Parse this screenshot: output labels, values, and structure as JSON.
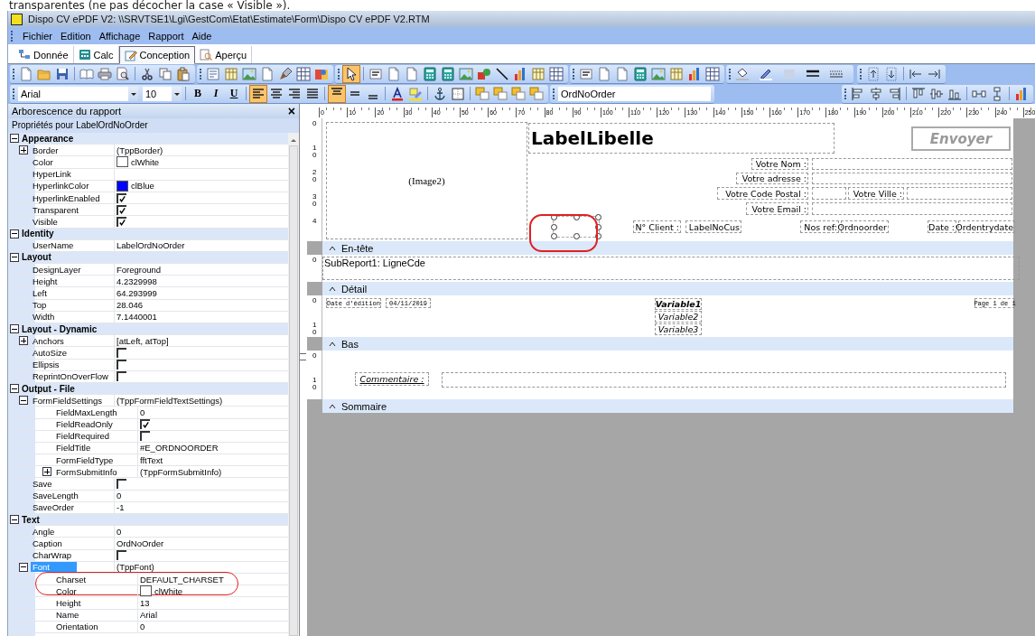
{
  "caption": "transparentes (ne pas décocher la case « Visible »).",
  "window": {
    "title": "Dispo CV ePDF V2: \\\\SRVTSE1\\Lgi\\GestCom\\Etat\\Estimate\\Form\\Dispo CV ePDF V2.RTM"
  },
  "menu": [
    "Fichier",
    "Edition",
    "Affichage",
    "Rapport",
    "Aide"
  ],
  "tabs": [
    {
      "label": "Donnée",
      "selected": false
    },
    {
      "label": "Calc",
      "selected": false
    },
    {
      "label": "Conception",
      "selected": true
    },
    {
      "label": "Aperçu",
      "selected": false
    }
  ],
  "toolbar": {
    "pointer_tool": {
      "selected": true
    },
    "font": "Arial",
    "size": "10",
    "format_buttons": [
      "B",
      "I",
      "U"
    ],
    "align": [
      {
        "selected": true
      },
      {
        "selected": false
      },
      {
        "selected": false
      },
      {
        "selected": false
      }
    ],
    "valign": [
      {
        "selected": true
      },
      {
        "selected": false
      },
      {
        "selected": false
      }
    ],
    "component_name": "OrdNoOrder"
  },
  "panel": {
    "title": "Arborescence du rapport",
    "close": "×",
    "subtitle": "Propriétés pour LabelOrdNoOrder"
  },
  "properties": [
    {
      "name": "Appearance",
      "expanded": true,
      "rows": [
        {
          "name": "Border",
          "kind": "text",
          "value": "(TppBorder)",
          "expanded": false,
          "selected": false
        },
        {
          "name": "Color",
          "kind": "color",
          "value": "clWhite",
          "color": "#ffffff",
          "selected": false
        },
        {
          "name": "HyperLink",
          "kind": "text",
          "selected": false
        },
        {
          "name": "HyperlinkColor",
          "kind": "color",
          "value": "clBlue",
          "color": "#0000ff",
          "selected": false
        },
        {
          "name": "HyperlinkEnabled",
          "kind": "check",
          "checked": true,
          "selected": false
        },
        {
          "name": "Transparent",
          "kind": "check",
          "checked": true,
          "selected": false
        },
        {
          "name": "Visible",
          "kind": "check",
          "checked": true,
          "selected": false
        }
      ]
    },
    {
      "name": "Identity",
      "expanded": true,
      "rows": [
        {
          "name": "UserName",
          "kind": "text",
          "value": "LabelOrdNoOrder",
          "selected": false
        }
      ]
    },
    {
      "name": "Layout",
      "expanded": true,
      "rows": [
        {
          "name": "DesignLayer",
          "kind": "text",
          "value": "Foreground",
          "selected": false
        },
        {
          "name": "Height",
          "kind": "text",
          "value": "4.2329998",
          "selected": false
        },
        {
          "name": "Left",
          "kind": "text",
          "value": "64.293999",
          "selected": false
        },
        {
          "name": "Top",
          "kind": "text",
          "value": "28.046",
          "selected": false
        },
        {
          "name": "Width",
          "kind": "text",
          "value": "7.1440001",
          "selected": false
        }
      ]
    },
    {
      "name": "Layout - Dynamic",
      "expanded": true,
      "rows": [
        {
          "name": "Anchors",
          "kind": "text",
          "value": "[atLeft, atTop]",
          "expanded": false,
          "selected": false
        },
        {
          "name": "AutoSize",
          "kind": "check",
          "checked": false,
          "selected": false
        },
        {
          "name": "Ellipsis",
          "kind": "check",
          "checked": false,
          "selected": false
        },
        {
          "name": "ReprintOnOverFlow",
          "kind": "check",
          "checked": false,
          "selected": false
        }
      ]
    },
    {
      "name": "Output - File",
      "expanded": true,
      "rows": [
        {
          "name": "FormFieldSettings",
          "kind": "text",
          "value": "(TppFormFieldTextSettings)",
          "expanded": true,
          "selected": false,
          "children": [
            {
              "name": "FieldMaxLength",
              "kind": "text",
              "value": "0",
              "selected": false
            },
            {
              "name": "FieldReadOnly",
              "kind": "check",
              "checked": true,
              "selected": false
            },
            {
              "name": "FieldRequired",
              "kind": "check",
              "checked": false,
              "selected": false
            },
            {
              "name": "FieldTitle",
              "kind": "text",
              "value": "#E_ORDNOORDER",
              "selected": false
            },
            {
              "name": "FormFieldType",
              "kind": "text",
              "value": "fftText",
              "selected": false
            },
            {
              "name": "FormSubmitInfo",
              "kind": "text",
              "value": "(TppFormSubmitInfo)",
              "expanded": false,
              "selected": false
            }
          ]
        },
        {
          "name": "Save",
          "kind": "check",
          "checked": false,
          "selected": false
        },
        {
          "name": "SaveLength",
          "kind": "text",
          "value": "0",
          "selected": false
        },
        {
          "name": "SaveOrder",
          "kind": "text",
          "value": "-1",
          "selected": false
        }
      ]
    },
    {
      "name": "Text",
      "expanded": true,
      "rows": [
        {
          "name": "Angle",
          "kind": "text",
          "value": "0",
          "selected": false
        },
        {
          "name": "Caption",
          "kind": "text",
          "value": "OrdNoOrder",
          "selected": false
        },
        {
          "name": "CharWrap",
          "kind": "check",
          "checked": false,
          "selected": false
        },
        {
          "name": "Font",
          "kind": "text",
          "value": "(TppFont)",
          "expanded": true,
          "selected": true,
          "children": [
            {
              "name": "Charset",
              "kind": "text",
              "value": "DEFAULT_CHARSET",
              "selected": false
            },
            {
              "name": "Color",
              "kind": "color",
              "value": "clWhite",
              "color": "#ffffff",
              "selected": false
            },
            {
              "name": "Height",
              "kind": "text",
              "value": "13",
              "selected": false
            },
            {
              "name": "Name",
              "kind": "text",
              "value": "Arial",
              "selected": false
            },
            {
              "name": "Orientation",
              "kind": "text",
              "value": "0",
              "selected": false
            }
          ]
        }
      ]
    }
  ],
  "ruler": [
    "0",
    "10",
    "20",
    "30",
    "40",
    "50",
    "60",
    "70",
    "80",
    "90",
    "100",
    "110",
    "120",
    "130",
    "140",
    "150",
    "160",
    "170",
    "180",
    "190",
    "200",
    "210",
    "220",
    "230",
    "240",
    "250"
  ],
  "bands": [
    {
      "label": "En-tête",
      "ruler_marks": [
        "0",
        "10",
        "20",
        "30",
        "4"
      ],
      "items": [
        {
          "kind": "image",
          "text": "(Image2)"
        },
        {
          "kind": "title",
          "text": "LabelLibelle"
        },
        {
          "kind": "button",
          "text": "Envoyer"
        },
        {
          "kind": "label",
          "text": "Votre Nom :"
        },
        {
          "kind": "field"
        },
        {
          "kind": "label",
          "text": "Votre adresse :"
        },
        {
          "kind": "field"
        },
        {
          "kind": "label",
          "text": "Votre Code Postal :"
        },
        {
          "kind": "field"
        },
        {
          "kind": "label",
          "text": "Votre Ville :"
        },
        {
          "kind": "field"
        },
        {
          "kind": "label",
          "text": "Votre Email :"
        },
        {
          "kind": "field"
        },
        {
          "kind": "handles"
        },
        {
          "kind": "label",
          "text": "N° Client :"
        },
        {
          "kind": "label",
          "text": "LabelNoCus"
        },
        {
          "kind": "label",
          "text": "Nos ref:"
        },
        {
          "kind": "label",
          "text": "Ordnoorder"
        },
        {
          "kind": "label",
          "text": "Date :"
        },
        {
          "kind": "label",
          "text": "Ordentrydate"
        }
      ]
    },
    {
      "label": "Détail",
      "ruler_marks": [
        "0"
      ],
      "items": [
        {
          "kind": "subreport",
          "text": "SubReport1: LigneCde"
        }
      ]
    },
    {
      "label": "Bas",
      "ruler_marks": [
        "0",
        "10"
      ],
      "items": [
        {
          "kind": "small",
          "text": "Date d'édition"
        },
        {
          "kind": "small",
          "text": "04/11/2019"
        },
        {
          "kind": "strong",
          "text": "Variable1"
        },
        {
          "kind": "var",
          "text": "Variable2"
        },
        {
          "kind": "var",
          "text": "Variable3"
        },
        {
          "kind": "small",
          "text": "Page 1 de 1"
        }
      ]
    },
    {
      "label": "Sommaire",
      "ruler_marks": [
        "0",
        "10"
      ],
      "items": [
        {
          "kind": "comment",
          "text": "Commentaire :"
        },
        {
          "kind": "field"
        }
      ]
    }
  ]
}
